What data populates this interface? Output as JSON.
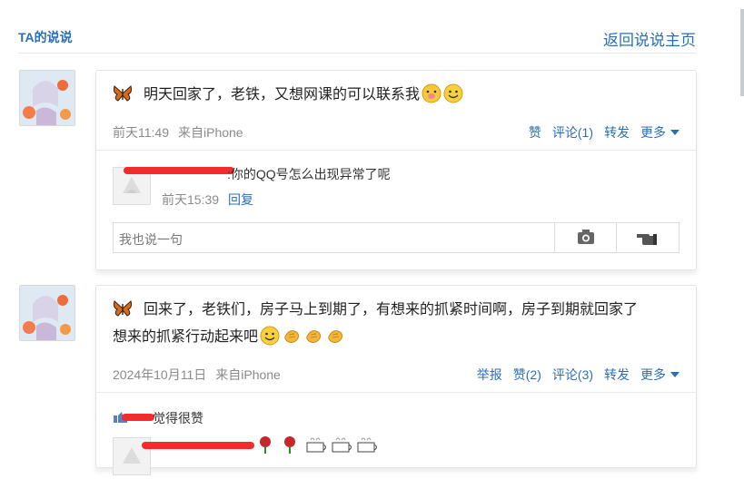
{
  "header": {
    "title": "TA的说说",
    "back_link": "返回说说主页"
  },
  "posts": [
    {
      "text": "明天回家了，老铁，又想网课的可以联系我",
      "time": "前天11:49",
      "source": "来自iPhone",
      "actions": {
        "like": "赞",
        "comment": "评论(1)",
        "forward": "转发",
        "more": "更多"
      },
      "comments": [
        {
          "text": ":你的QQ号怎么出现异常了呢",
          "time": "前天15:39",
          "reply": "回复"
        }
      ],
      "reply_placeholder": "我也说一句"
    },
    {
      "text_line1": "回来了，老铁们，房子马上到期了，有想来的抓紧时间啊，房子到期就回家了",
      "text_line2": "想来的抓紧行动起来吧",
      "time": "2024年10月11日",
      "source": "来自iPhone",
      "actions": {
        "report": "举报",
        "like": "赞(2)",
        "comment": "评论(3)",
        "forward": "转发",
        "more": "更多"
      },
      "likes_text": "觉得很赞"
    }
  ],
  "colors": {
    "link": "#2a6fb5",
    "redaction": "#f22b2b",
    "meta": "#8a8a8a"
  }
}
